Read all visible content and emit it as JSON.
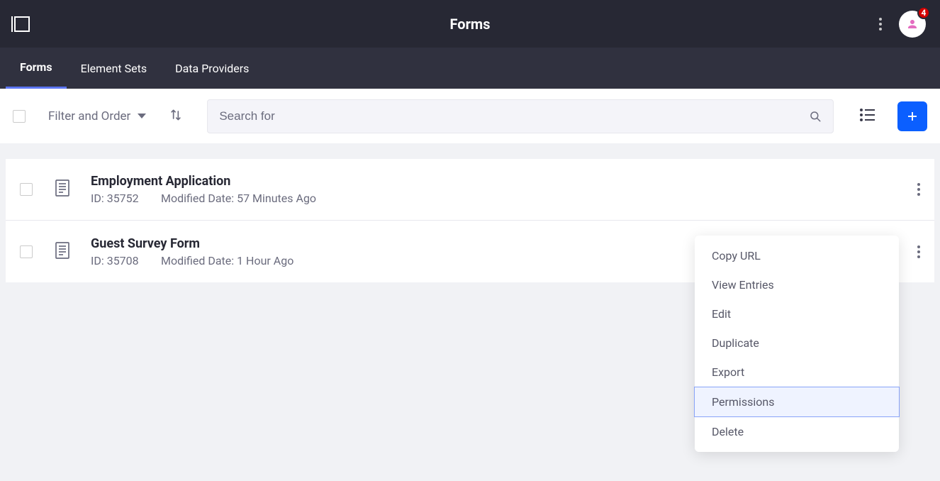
{
  "header": {
    "title": "Forms",
    "notification_count": "4"
  },
  "tabs": [
    {
      "label": "Forms",
      "active": true
    },
    {
      "label": "Element Sets",
      "active": false
    },
    {
      "label": "Data Providers",
      "active": false
    }
  ],
  "toolbar": {
    "filter_label": "Filter and Order",
    "search_placeholder": "Search for"
  },
  "rows": [
    {
      "title": "Employment Application",
      "id_label": "ID: 35752",
      "modified_label": "Modified Date: 57 Minutes Ago"
    },
    {
      "title": "Guest Survey Form",
      "id_label": "ID: 35708",
      "modified_label": "Modified Date: 1 Hour Ago"
    }
  ],
  "menu": {
    "items": [
      "Copy URL",
      "View Entries",
      "Edit",
      "Duplicate",
      "Export",
      "Permissions",
      "Delete"
    ],
    "highlighted": "Permissions"
  }
}
